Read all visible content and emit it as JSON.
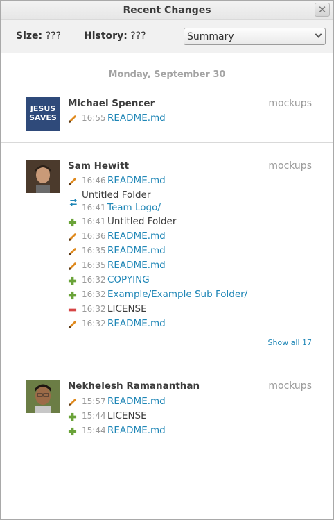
{
  "window": {
    "title": "Recent Changes"
  },
  "toolbar": {
    "size_label": "Size:",
    "size_value": "???",
    "history_label": "History:",
    "history_value": "???",
    "view_select": {
      "selected": "Summary"
    }
  },
  "date_header": "Monday, September 30",
  "groups": [
    {
      "author": "Michael Spencer",
      "repo": "mockups",
      "avatar_text": [
        "JESUS",
        "SAVES"
      ],
      "entries": [
        {
          "icon": "pencil-icon",
          "time": "16:55",
          "path": "README.md",
          "is_link": true
        }
      ]
    },
    {
      "author": "Sam Hewitt",
      "repo": "mockups",
      "entries": [
        {
          "icon": "pencil-icon",
          "time": "16:46",
          "path": "README.md",
          "is_link": true
        },
        {
          "icon": "rename-icon",
          "time": "16:41",
          "old_name": "Untitled Folder",
          "path": "Team Logo/",
          "is_link": true
        },
        {
          "icon": "plus-icon",
          "time": "16:41",
          "path": "Untitled Folder",
          "is_link": false
        },
        {
          "icon": "pencil-icon",
          "time": "16:36",
          "path": "README.md",
          "is_link": true
        },
        {
          "icon": "pencil-icon",
          "time": "16:35",
          "path": "README.md",
          "is_link": true
        },
        {
          "icon": "pencil-icon",
          "time": "16:35",
          "path": "README.md",
          "is_link": true
        },
        {
          "icon": "plus-icon",
          "time": "16:32",
          "path": "COPYING",
          "is_link": true
        },
        {
          "icon": "plus-icon",
          "time": "16:32",
          "path": "Example/Example Sub Folder/",
          "is_link": true
        },
        {
          "icon": "minus-icon",
          "time": "16:32",
          "path": "LICENSE",
          "is_link": false
        },
        {
          "icon": "pencil-icon",
          "time": "16:32",
          "path": "README.md",
          "is_link": true
        }
      ],
      "show_all": "Show all 17"
    },
    {
      "author": "Nekhelesh Ramananthan",
      "repo": "mockups",
      "entries": [
        {
          "icon": "pencil-icon",
          "time": "15:57",
          "path": "README.md",
          "is_link": true
        },
        {
          "icon": "plus-icon",
          "time": "15:44",
          "path": "LICENSE",
          "is_link": false
        },
        {
          "icon": "plus-icon",
          "time": "15:44",
          "path": "README.md",
          "is_link": true
        }
      ]
    }
  ],
  "colors": {
    "link": "#1f86b6",
    "muted": "#9a9a9a",
    "add": "#6aa339",
    "remove": "#d64545",
    "edit": "#e08a1e"
  }
}
